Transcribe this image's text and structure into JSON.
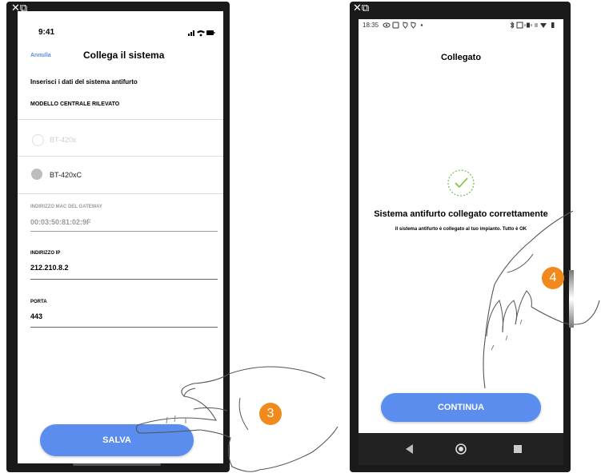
{
  "left_phone": {
    "corner_icon": "close-window-icon",
    "status_time": "9:41",
    "status_icons": [
      "signal-icon",
      "wifi-icon",
      "battery-icon"
    ],
    "header": {
      "cancel_label": "Annulla",
      "title": "Collega il sistema"
    },
    "instruction": "Inserisci i dati del sistema antifurto",
    "section_label": "MODELLO CENTRALE RILEVATO",
    "options": [
      {
        "label": "BT-420x",
        "selected": false,
        "disabled": true
      },
      {
        "label": "BT-420xC",
        "selected": true,
        "disabled": false
      }
    ],
    "fields": {
      "mac": {
        "label": "INDIRIZZO MAC DEL GATEWAY",
        "value": "00:03:50:81:02:9F"
      },
      "ip": {
        "label": "INDIRIZZO IP",
        "value": "212.210.8.2"
      },
      "port": {
        "label": "PORTA",
        "value": "443"
      }
    },
    "save_label": "SALVA",
    "step_badge": "3"
  },
  "right_phone": {
    "corner_icon": "close-window-icon",
    "status_time": "18:35",
    "status_icons_left": [
      "eye-icon",
      "screen-icon",
      "shield-icon",
      "shield-icon",
      "dot-icon"
    ],
    "status_icons_right": [
      "bluetooth-icon",
      "nfc-icon",
      "vibrate-icon",
      "data-icon",
      "wifi-icon",
      "battery-icon"
    ],
    "title": "Collegato",
    "success_icon": "check-circle-icon",
    "headline": "Sistema antifurto collegato correttamente",
    "subtext": "Il sistema antifurto è collegato al tuo impianto. Tutto è OK",
    "continue_label": "CONTINUA",
    "step_badge": "4",
    "nav_icons": [
      "back-icon",
      "home-icon",
      "recents-icon"
    ]
  },
  "colors": {
    "accent": "#5b8def",
    "badge": "#f08a1c",
    "success": "#7bc043",
    "phone_frame": "#1a1a1a",
    "nav_bar": "#222222"
  }
}
